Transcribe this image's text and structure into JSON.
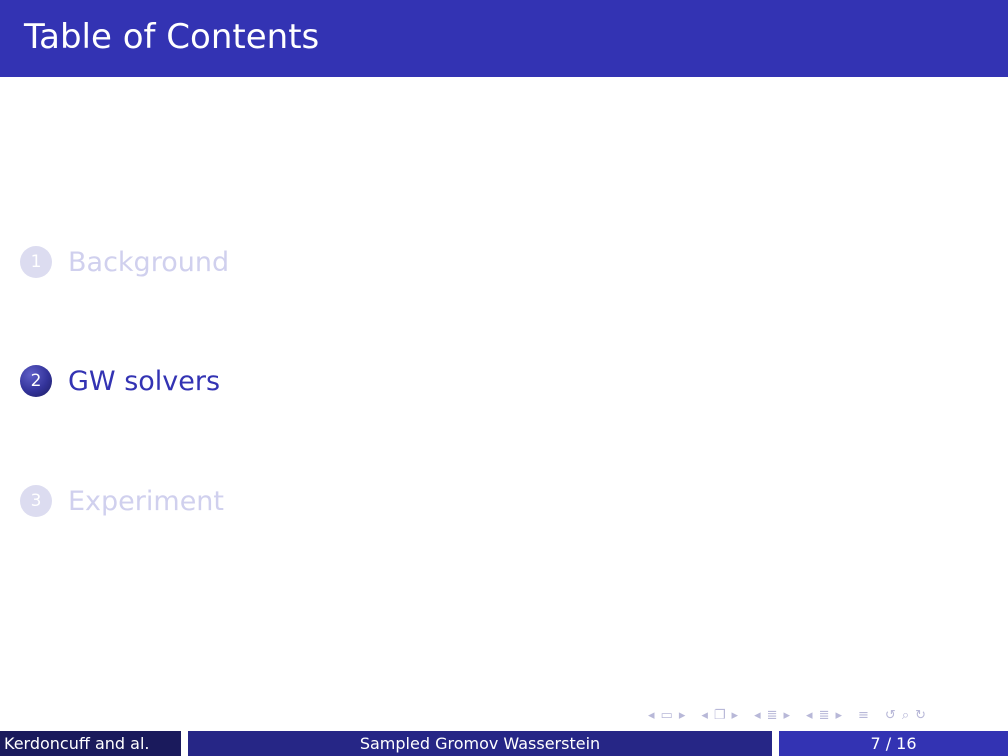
{
  "frame": {
    "title": "Table of Contents"
  },
  "toc": [
    {
      "number": "1",
      "label": "Background",
      "state": "inactive"
    },
    {
      "number": "2",
      "label": "GW solvers",
      "state": "active"
    },
    {
      "number": "3",
      "label": "Experiment",
      "state": "inactive"
    }
  ],
  "nav_icons": [
    "nav-left-arrow",
    "slide-icon",
    "nav-right-arrow",
    "nav-left-arrow",
    "frame-icon",
    "nav-right-arrow",
    "nav-left-arrow",
    "subsection-icon",
    "nav-right-arrow",
    "nav-left-arrow",
    "section-icon",
    "nav-right-arrow",
    "align-icon",
    "undo-icon",
    "search-icon",
    "redo-icon"
  ],
  "footer": {
    "author": "Kerdoncuff and al.",
    "title": "Sampled Gromov Wasserstein",
    "page": "7 / 16"
  },
  "colors": {
    "primary": "#3333b3",
    "footer_dark": "#1a1a5c",
    "footer_mid": "#262686",
    "inactive_text": "#d0d0ee"
  }
}
